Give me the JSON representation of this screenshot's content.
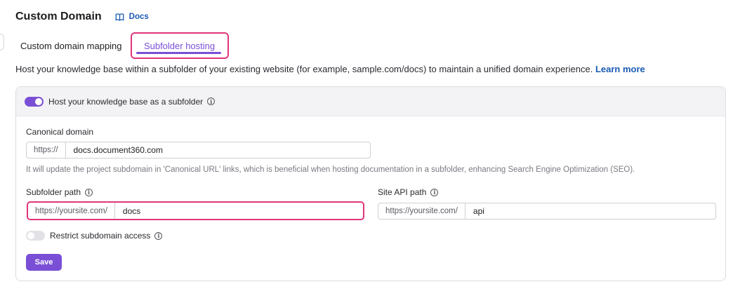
{
  "header": {
    "title": "Custom Domain",
    "docs_label": "Docs"
  },
  "tabs": [
    {
      "label": "Custom domain mapping",
      "active": false
    },
    {
      "label": "Subfolder hosting",
      "active": true
    }
  ],
  "description": {
    "text": "Host your knowledge base within a subfolder of your existing website (for example, sample.com/docs) to maintain a unified domain experience.",
    "link": "Learn more"
  },
  "card": {
    "host_toggle": {
      "label": "Host your knowledge base as a subfolder",
      "on": true
    },
    "canonical": {
      "label": "Canonical domain",
      "prefix": "https://",
      "value": "docs.document360.com",
      "helper": "It will update the project subdomain in 'Canonical URL' links, which is beneficial when hosting documentation in a subfolder, enhancing Search Engine Optimization (SEO)."
    },
    "subfolder_path": {
      "label": "Subfolder path",
      "prefix": "https://yoursite.com/",
      "value": "docs"
    },
    "site_api_path": {
      "label": "Site API path",
      "prefix": "https://yoursite.com/",
      "value": "api"
    },
    "restrict_toggle": {
      "label": "Restrict subdomain access",
      "on": false
    },
    "save_label": "Save"
  },
  "colors": {
    "accent": "#7a4fd6",
    "highlight": "#e0367a",
    "link": "#1a5bb5"
  }
}
